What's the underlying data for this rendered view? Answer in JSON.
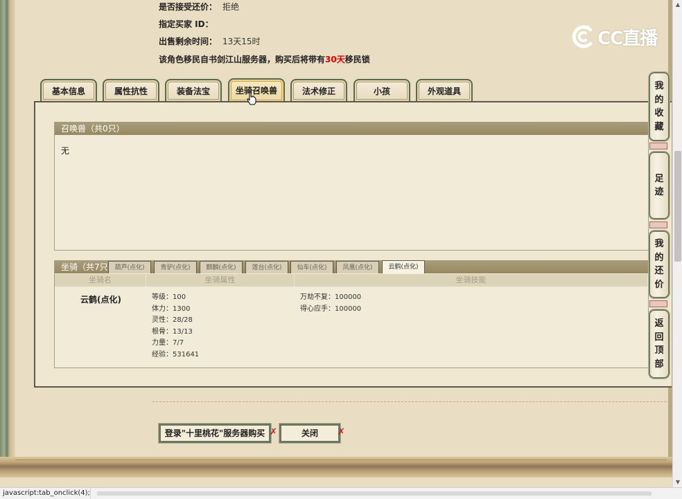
{
  "info": {
    "accept_counter_label": "是否接受还价：",
    "accept_counter_value": "拒绝",
    "buyer_id_label": "指定买家 ID：",
    "buyer_id_value": "",
    "time_left_label": "出售剩余时间：",
    "time_left_value": "13天15时",
    "migration_prefix": "该角色移民自书剑江山服务器，购买后将带有",
    "migration_days": "30天",
    "migration_suffix": "移民锁"
  },
  "logo": {
    "text": "CC直播"
  },
  "tabs": [
    {
      "label": "基本信息"
    },
    {
      "label": "属性抗性"
    },
    {
      "label": "装备法宝"
    },
    {
      "label": "坐骑召唤兽"
    },
    {
      "label": "法术修正"
    },
    {
      "label": "小孩"
    },
    {
      "label": "外观道具"
    }
  ],
  "summon": {
    "title": "召唤兽（共0只）",
    "empty_text": "无"
  },
  "mount": {
    "title": "坐骑（共7只）",
    "tabs": [
      "葫芦(点化)",
      "青驴(点化)",
      "麒麟(点化)",
      "莲台(点化)",
      "仙车(点化)",
      "凤凰(点化)",
      "云鹤(点化)"
    ],
    "columns": [
      "坐骑名",
      "坐骑属性",
      "坐骑技能"
    ],
    "selected": {
      "name": "云鹤(点化)",
      "attributes": [
        "等级：100",
        "体力：1300",
        "灵性：28/28",
        "根骨：13/13",
        "力量：7/7",
        "经验：531641"
      ],
      "skills": [
        "万劫不复：100000",
        "得心应手：100000"
      ]
    }
  },
  "buttons": {
    "buy": "登录\"十里桃花\"服务器购买",
    "close": "关闭"
  },
  "side_nav": [
    {
      "label": "我的收藏",
      "chars": [
        "我",
        "的",
        "收",
        "藏"
      ]
    },
    {
      "label": "足迹",
      "chars": [
        "足",
        "迹"
      ]
    },
    {
      "label": "我的还价",
      "chars": [
        "我",
        "的",
        "还",
        "价"
      ]
    },
    {
      "label": "返回顶部",
      "chars": [
        "返",
        "回",
        "顶",
        "部"
      ]
    }
  ],
  "status_bar": {
    "text": "javascript:tab_onclick(4);"
  },
  "colors": {
    "accent_red": "#e00000",
    "title_bar": "#a39874",
    "frame_green": "#6b7a60"
  }
}
